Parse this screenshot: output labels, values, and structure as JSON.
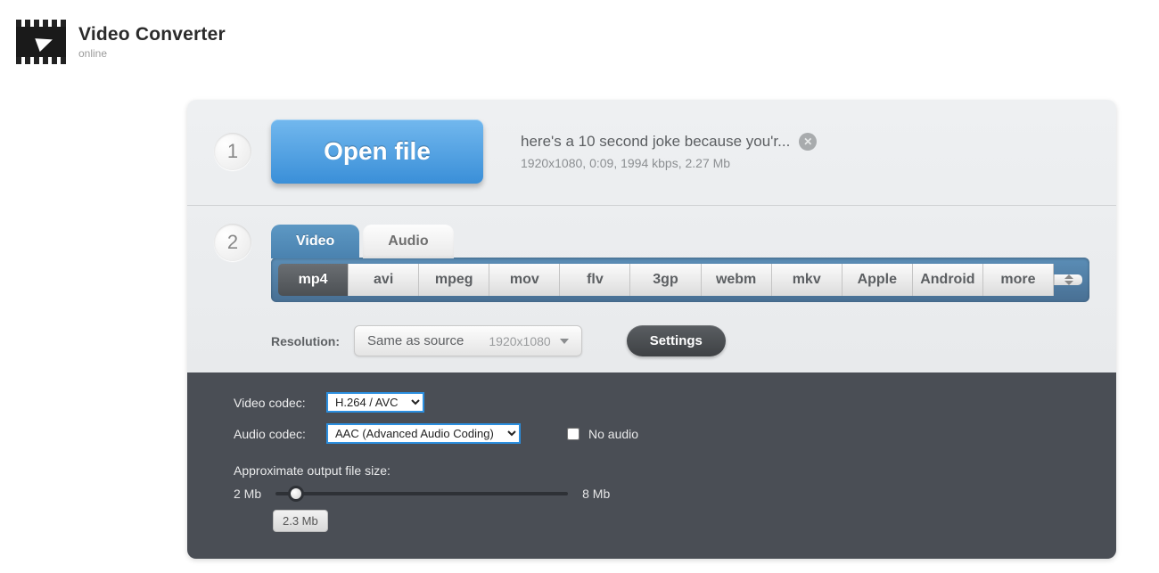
{
  "logo": {
    "title": "Video Converter",
    "sub": "online"
  },
  "step1": {
    "num": "1",
    "open_label": "Open file",
    "file_name": "here's a 10 second joke because you'r...",
    "file_meta": "1920x1080, 0:09, 1994 kbps, 2.27 Mb"
  },
  "step2": {
    "num": "2",
    "tabs": {
      "video": "Video",
      "audio": "Audio"
    },
    "formats": [
      "mp4",
      "avi",
      "mpeg",
      "mov",
      "flv",
      "3gp",
      "webm",
      "mkv",
      "Apple",
      "Android",
      "more"
    ],
    "active_format_index": 0,
    "resolution": {
      "label": "Resolution:",
      "value": "Same as source",
      "dim": "1920x1080"
    },
    "settings_label": "Settings"
  },
  "advanced": {
    "video_codec_label": "Video codec:",
    "video_codec_value": "H.264 / AVC",
    "audio_codec_label": "Audio codec:",
    "audio_codec_value": "AAC (Advanced Audio Coding)",
    "no_audio_label": "No audio",
    "approx_label": "Approximate output file size:",
    "slider_min": "2 Mb",
    "slider_max": "8 Mb",
    "size_badge": "2.3 Mb"
  }
}
